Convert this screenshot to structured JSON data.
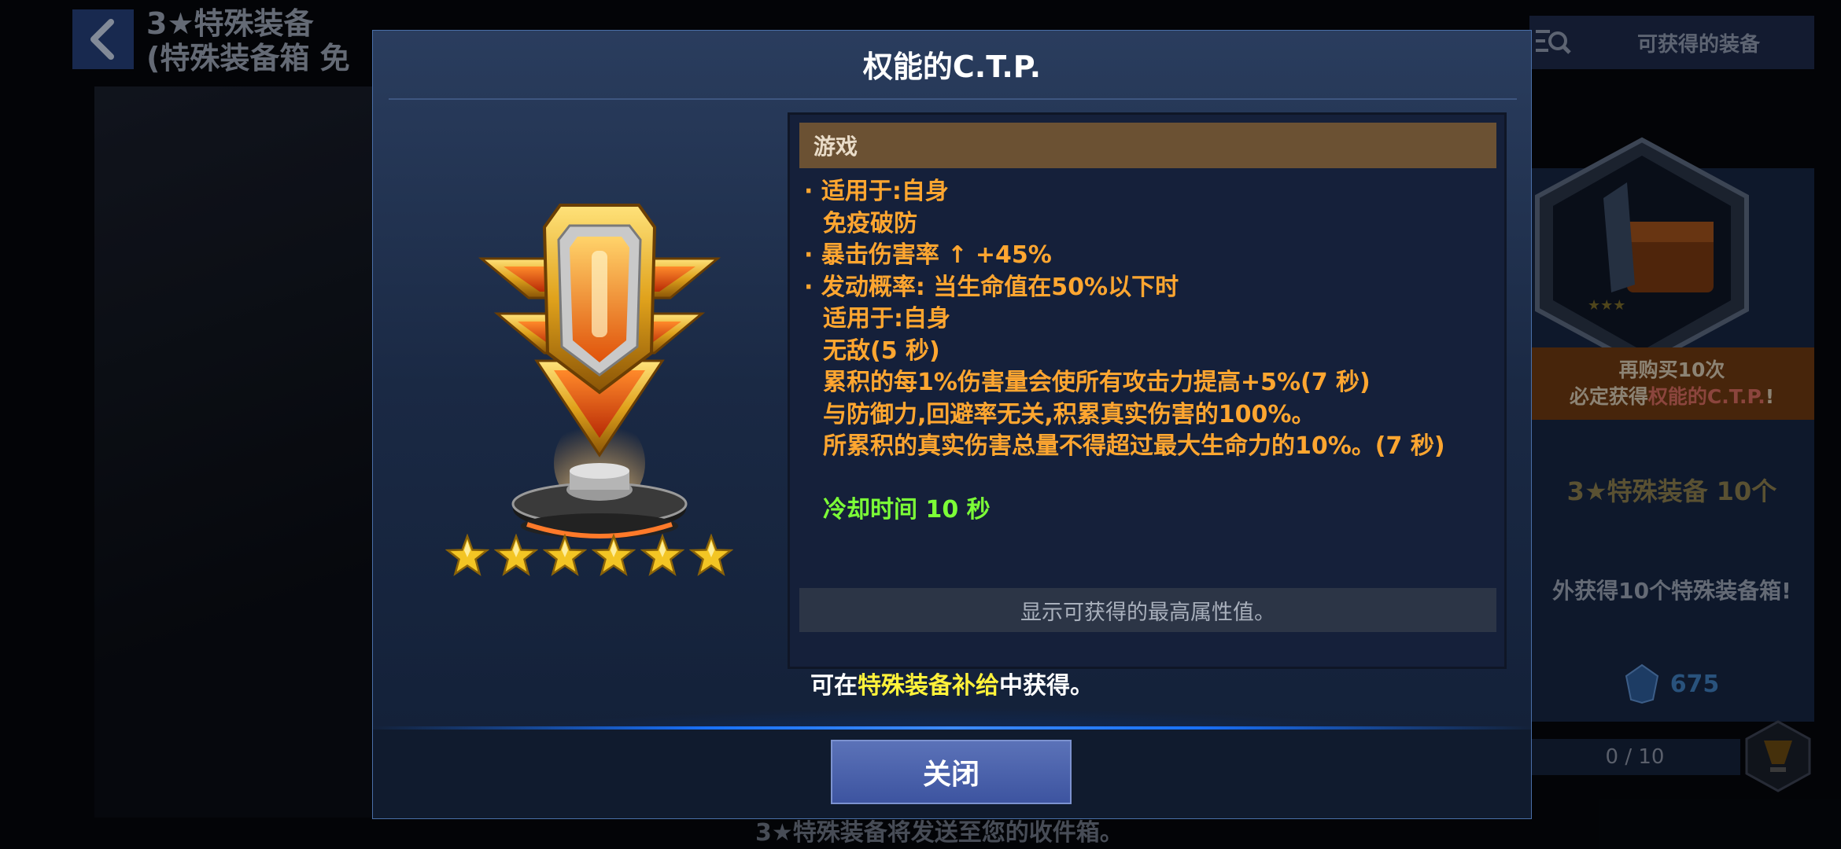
{
  "background": {
    "title_line1": "3★特殊装备",
    "title_line2": "(特殊装备箱 免",
    "available_tab": "可获得的装备",
    "banner_line1": "再购买10次",
    "banner_line2_prefix": "必定获得",
    "banner_line2_item": "权能的C.T.P.",
    "banner_line2_suffix": "!",
    "reward_count": "3★特殊装备 10个",
    "extra_reward": "外获得10个特殊装备箱!",
    "price": "675",
    "progress": "0 / 10",
    "footer_note": "3★特殊装备将发送至您的收件箱。"
  },
  "modal": {
    "title": "权能的C.T.P.",
    "star_count": 6,
    "category": "游戏",
    "description": [
      {
        "text": "· 适用于:自身",
        "style": "normal"
      },
      {
        "text": "免疫破防",
        "style": "indent"
      },
      {
        "text": "· 暴击伤害率 ↑ +45%",
        "style": "normal"
      },
      {
        "text": "· 发动概率: 当生命值在50%以下时",
        "style": "normal"
      },
      {
        "text": "适用于:自身",
        "style": "indent"
      },
      {
        "text": "无敌(5 秒)",
        "style": "indent"
      },
      {
        "text": "累积的每1%伤害量会使所有攻击力提高+5%(7 秒)",
        "style": "indent"
      },
      {
        "text": "与防御力,回避率无关,积累真实伤害的100%。",
        "style": "indent"
      },
      {
        "text": "所累积的真实伤害总量不得超过最大生命力的10%。(7 秒)",
        "style": "indent"
      },
      {
        "text": "冷却时间 10 秒",
        "style": "cool"
      }
    ],
    "show_max_label": "显示可获得的最高属性值。",
    "obtain_prefix": "可在",
    "obtain_source": "特殊装备补给",
    "obtain_suffix": "中获得。",
    "close_label": "关闭"
  },
  "colors": {
    "description_text": "#ffa630",
    "cooldown_text": "#7cff37",
    "highlight_source": "#fff23a",
    "close_button": "#4a61ad"
  },
  "icons": [
    "back-arrow-icon",
    "search-list-icon",
    "equipment-box-icon",
    "crystal-icon",
    "trophy-icon",
    "star-icon",
    "ctp-trophy-icon"
  ]
}
